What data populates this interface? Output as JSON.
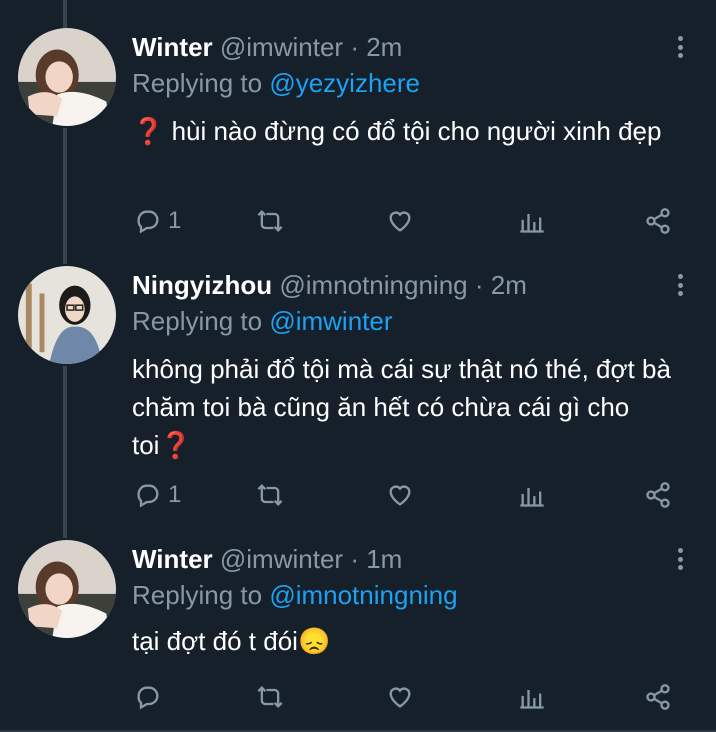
{
  "tweets": [
    {
      "name": "Winter",
      "handle": "@imwinter",
      "separator": "·",
      "time": "2m",
      "replying_prefix": "Replying to",
      "replying_to": "@yezyizhere",
      "text_emoji": "❓",
      "text": " hùi nào đừng có đổ tội cho người xinh đẹp",
      "reply_count": "1",
      "avatar": "winter-avatar"
    },
    {
      "name": "Ningyizhou",
      "handle": "@imnotningning",
      "separator": "·",
      "time": "2m",
      "replying_prefix": "Replying to",
      "replying_to": "@imwinter",
      "text": "không phải đổ tội mà cái sự thật nó thé, đợt bà chăm toi bà cũng ăn hết có chừa cái gì cho toi",
      "text_emoji": "❓",
      "reply_count": "1",
      "avatar": "ningyizhou-avatar"
    },
    {
      "name": "Winter",
      "handle": "@imwinter",
      "separator": "·",
      "time": "1m",
      "replying_prefix": "Replying to",
      "replying_to": "@imnotningning",
      "text": "tại đợt đó t đói",
      "text_emoji": "😞",
      "reply_count": "",
      "avatar": "winter-avatar"
    }
  ],
  "icons": [
    "reply-icon",
    "retweet-icon",
    "like-icon",
    "analytics-icon",
    "share-icon",
    "more-icon"
  ],
  "colors": {
    "background": "#15202b",
    "secondary_text": "#8899a6",
    "mention": "#1da1f2",
    "thread_line": "#38444d"
  }
}
